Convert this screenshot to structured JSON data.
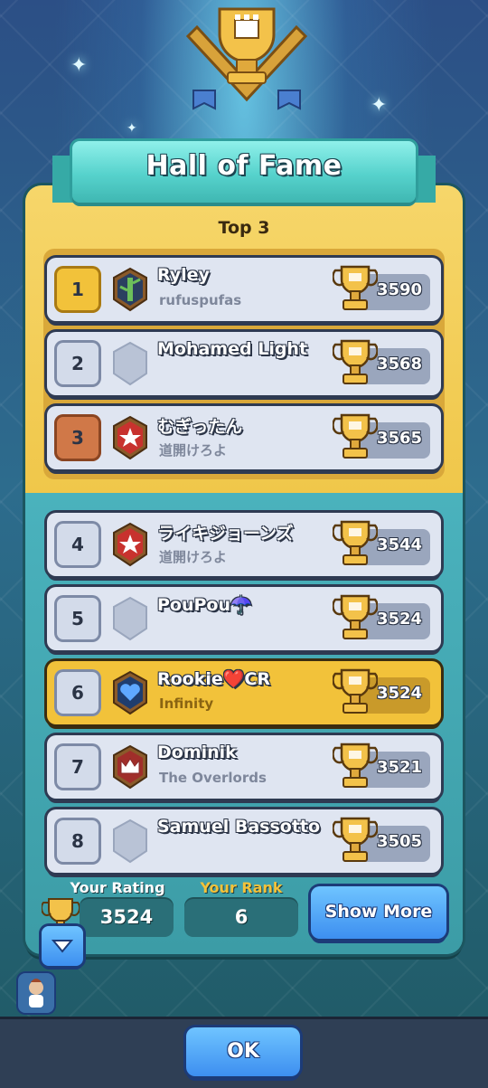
{
  "header": {
    "title": "Hall of Fame",
    "section_title": "Top 3"
  },
  "players": [
    {
      "rank": "1",
      "name": "Ryley",
      "clan": "rufuspufas",
      "trophies": "3590",
      "badge": "bamboo-badge"
    },
    {
      "rank": "2",
      "name": "Mohamed Light",
      "clan": "",
      "trophies": "3568",
      "badge": "empty-badge"
    },
    {
      "rank": "3",
      "name": "むぎったん",
      "clan": "道開けろよ",
      "trophies": "3565",
      "badge": "star-badge"
    },
    {
      "rank": "4",
      "name": "ライキジョーンズ",
      "clan": "道開けろよ",
      "trophies": "3544",
      "badge": "star-badge"
    },
    {
      "rank": "5",
      "name": "PouPou☂️",
      "clan": "",
      "trophies": "3524",
      "badge": "empty-badge"
    },
    {
      "rank": "6",
      "name": "Rookie❤️CR",
      "clan": "Infinity",
      "trophies": "3524",
      "badge": "heart-badge"
    },
    {
      "rank": "7",
      "name": "Dominik",
      "clan": "The Overlords",
      "trophies": "3521",
      "badge": "crown-badge"
    },
    {
      "rank": "8",
      "name": "Samuel Bassotto",
      "clan": "",
      "trophies": "3505",
      "badge": "empty-badge"
    }
  ],
  "footer": {
    "your_rating_label": "Your Rating",
    "your_rating": "3524",
    "your_rank_label": "Your Rank",
    "your_rank": "6",
    "show_more_label": "Show More",
    "ok_label": "OK"
  },
  "colors": {
    "gold": "#f2c23a",
    "bronze": "#d07848",
    "teal_panel": "#3b9aa6",
    "blue_button": "#3d8ff0"
  }
}
